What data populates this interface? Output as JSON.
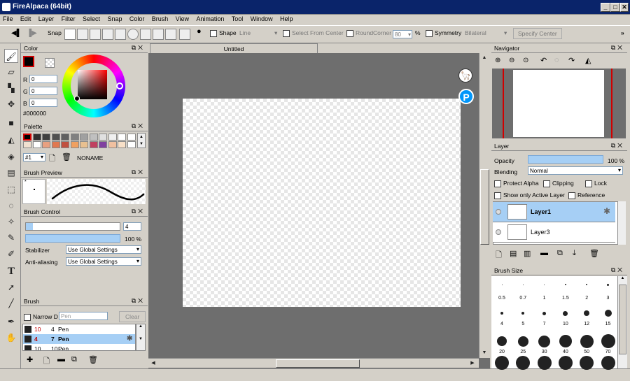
{
  "window": {
    "title": "FireAlpaca (64bit)"
  },
  "menu": [
    "File",
    "Edit",
    "Layer",
    "Filter",
    "Select",
    "Snap",
    "Color",
    "Brush",
    "View",
    "Animation",
    "Tool",
    "Window",
    "Help"
  ],
  "toolbar": {
    "snap_label": "Snap",
    "shape_label": "Shape",
    "shape_value": "Line",
    "select_from_center": "Select From Center",
    "round_corner": "RoundCorner",
    "round_value": "80",
    "percent": "%",
    "symmetry": "Symmetry",
    "symmetry_value": "Bilateral",
    "specify_center": "Specify Center"
  },
  "canvas": {
    "tab": "Untitled"
  },
  "color": {
    "title": "Color",
    "r_label": "R",
    "g_label": "G",
    "b_label": "B",
    "r": "0",
    "g": "0",
    "b": "0",
    "hex": "#000000"
  },
  "palette": {
    "title": "Palette",
    "selector": "#1",
    "name": "NONAME",
    "colors": [
      "#000000",
      "#303030",
      "#404040",
      "#505050",
      "#606060",
      "#808080",
      "#a0a0a0",
      "#c0c0c0",
      "#e0e0e0",
      "#f0f0f0",
      "#ffffff",
      "#ffffff",
      "#f0e0d0",
      "#ffffff",
      "#e8a080",
      "#e07850",
      "#c05040",
      "#f0a060",
      "#e8c090",
      "#c04060",
      "#8040a0",
      "#f0c0a0",
      "#f8e0c8",
      "#ffffff"
    ]
  },
  "brush_preview": {
    "title": "Brush Preview"
  },
  "brush_control": {
    "title": "Brush Control",
    "size": "4",
    "opacity": "100 %",
    "stabilizer_label": "Stabilizer",
    "stabilizer_value": "Use Global Settings",
    "antialias_label": "Anti-aliasing",
    "antialias_value": "Use Global Settings"
  },
  "brush": {
    "title": "Brush",
    "narrow_label": "Narrow D",
    "search_placeholder": "Pen",
    "clear": "Clear",
    "items": [
      {
        "size": "10",
        "num": "4",
        "name": "Pen"
      },
      {
        "size": "4",
        "num": "7",
        "name": "Pen"
      },
      {
        "size": "10",
        "num": "10",
        "name": "Pen"
      }
    ]
  },
  "navigator": {
    "title": "Navigator"
  },
  "layer": {
    "title": "Layer",
    "opacity_label": "Opacity",
    "opacity_value": "100 %",
    "blending_label": "Blending",
    "blending_value": "Normal",
    "protect_alpha": "Protect Alpha",
    "clipping": "Clipping",
    "lock": "Lock",
    "show_active": "Show only Active Layer",
    "reference": "Reference",
    "layers": [
      "Layer1",
      "Layer3"
    ]
  },
  "brush_size": {
    "title": "Brush Size",
    "labels": [
      "0.5",
      "0.7",
      "1",
      "1.5",
      "2",
      "3",
      "4",
      "5",
      "7",
      "10",
      "12",
      "15",
      "20",
      "25",
      "30",
      "40",
      "50",
      "70"
    ]
  },
  "accent": {
    "selection": "#a6cff5",
    "titlebar": "#0a246a",
    "nav_red": "#d00000"
  }
}
